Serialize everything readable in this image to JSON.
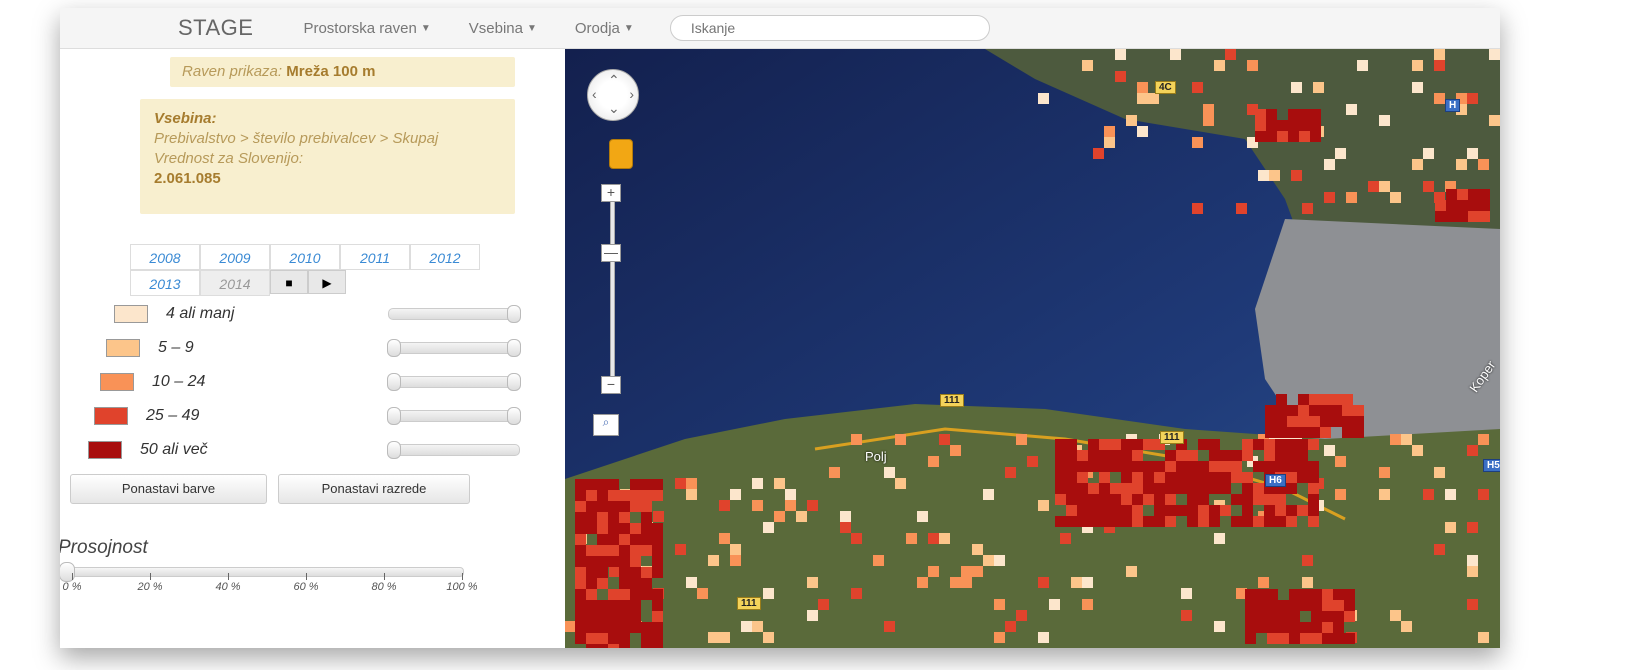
{
  "app": {
    "brand": "STAGE"
  },
  "menu": {
    "items": [
      {
        "label": "Prostorska raven"
      },
      {
        "label": "Vsebina"
      },
      {
        "label": "Orodja"
      }
    ],
    "search_placeholder": "Iskanje"
  },
  "sidebar": {
    "display_level_label": "Raven prikaza:",
    "display_level_value": "Mreža 100 m",
    "content_label": "Vsebina:",
    "content_path": "Prebivalstvo > število prebivalcev > Skupaj",
    "slovenia_label": "Vrednost za Slovenijo:",
    "slovenia_value": "2.061.085",
    "years_row1": [
      "2008",
      "2009",
      "2010",
      "2011",
      "2012"
    ],
    "years_row2": [
      "2013",
      "2014"
    ],
    "selected_year": "2014",
    "stop_icon": "■",
    "play_icon": "▶",
    "legend": [
      {
        "label": "4 ali manj",
        "color": "#fce6cc"
      },
      {
        "label": "5 – 9",
        "color": "#fcc58a"
      },
      {
        "label": "10 – 24",
        "color": "#f99257"
      },
      {
        "label": "25 – 49",
        "color": "#e0432c"
      },
      {
        "label": "50 ali več",
        "color": "#a80d0d"
      }
    ],
    "reset_colors_label": "Ponastavi barve",
    "reset_classes_label": "Ponastavi razrede",
    "transparency_title": "Prosojnost",
    "transparency_value": 0,
    "transparency_ticks": [
      "0 %",
      "20 %",
      "40 %",
      "60 %",
      "80 %",
      "100 %"
    ]
  },
  "map": {
    "road_labels": [
      "111",
      "111",
      "111",
      "4C"
    ],
    "badge_labels": [
      "H6",
      "H5",
      "H"
    ],
    "place_labels": [
      "Polj",
      "Koper"
    ]
  }
}
